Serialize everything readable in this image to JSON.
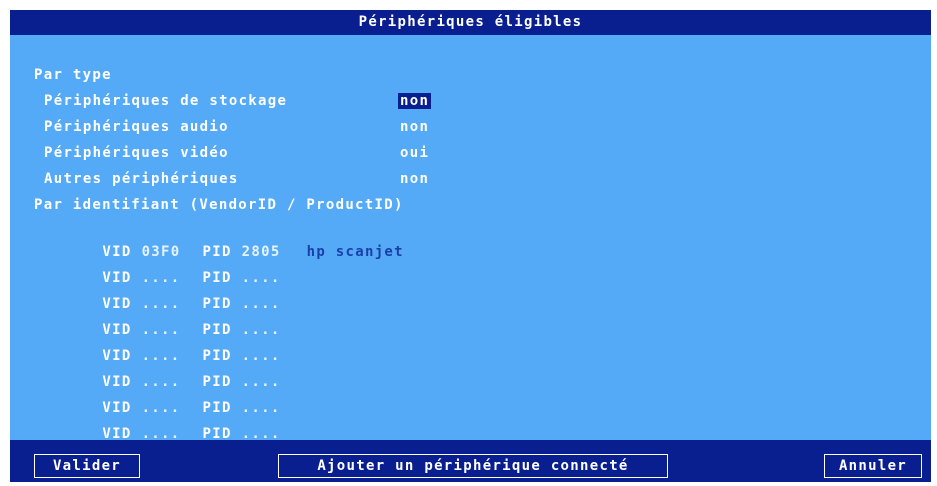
{
  "window": {
    "title": "Périphériques éligibles"
  },
  "by_type": {
    "header": "Par type",
    "items": [
      {
        "label": "Périphériques de stockage",
        "value": "non"
      },
      {
        "label": "Périphériques audio",
        "value": "non"
      },
      {
        "label": "Périphériques vidéo",
        "value": "oui"
      },
      {
        "label": "Autres périphériques",
        "value": "non"
      }
    ]
  },
  "by_id": {
    "header": "Par identifiant (VendorID / ProductID)",
    "vid_label": "VID",
    "pid_label": "PID",
    "rows": [
      {
        "vid": "03F0",
        "pid": "2805",
        "desc": "hp scanjet"
      },
      {
        "vid": "....",
        "pid": "....",
        "desc": ""
      },
      {
        "vid": "....",
        "pid": "....",
        "desc": ""
      },
      {
        "vid": "....",
        "pid": "....",
        "desc": ""
      },
      {
        "vid": "....",
        "pid": "....",
        "desc": ""
      },
      {
        "vid": "....",
        "pid": "....",
        "desc": ""
      },
      {
        "vid": "....",
        "pid": "....",
        "desc": ""
      },
      {
        "vid": "....",
        "pid": "....",
        "desc": ""
      }
    ]
  },
  "buttons": {
    "validate": "Valider",
    "add_connected": "Ajouter un périphérique connecté",
    "cancel": "Annuler"
  },
  "colors": {
    "title_bar": "#0a1f8f",
    "panel": "#54aaf7",
    "text": "#ffffff",
    "description": "#1a3fa8"
  }
}
